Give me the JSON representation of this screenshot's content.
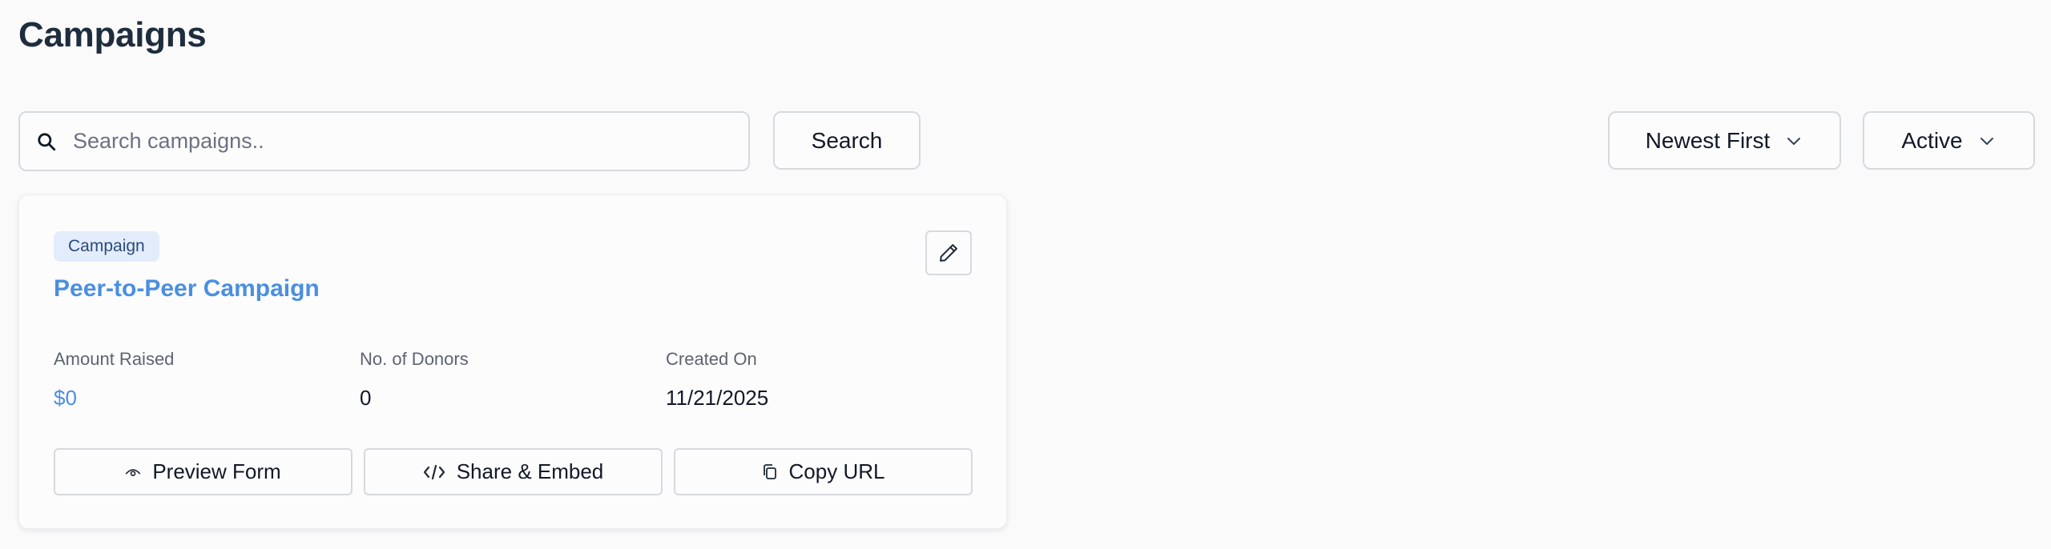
{
  "page": {
    "title": "Campaigns"
  },
  "search": {
    "placeholder": "Search campaigns..",
    "value": "",
    "button_label": "Search",
    "icon": "search-icon"
  },
  "filters": {
    "sort": {
      "selected": "Newest First",
      "icon": "chevron-down-icon"
    },
    "status": {
      "selected": "Active",
      "icon": "chevron-down-icon"
    }
  },
  "campaign_card": {
    "tag": "Campaign",
    "title": "Peer-to-Peer Campaign",
    "edit_icon": "pencil-icon",
    "stats": {
      "amount_raised_label": "Amount Raised",
      "amount_raised_value": "$0",
      "donors_label": "No. of Donors",
      "donors_value": "0",
      "created_label": "Created On",
      "created_value": "11/21/2025"
    },
    "actions": {
      "preview_label": "Preview Form",
      "preview_icon": "eye-icon",
      "share_label": "Share & Embed",
      "share_icon": "code-icon",
      "copy_label": "Copy URL",
      "copy_icon": "copy-icon"
    }
  },
  "colors": {
    "accent": "#4a8fe0",
    "title": "#1e2d3d",
    "tag_bg": "#e3ecfb",
    "tag_text": "#2b4b7e",
    "border": "#d6d9de",
    "background": "#fafafa"
  }
}
